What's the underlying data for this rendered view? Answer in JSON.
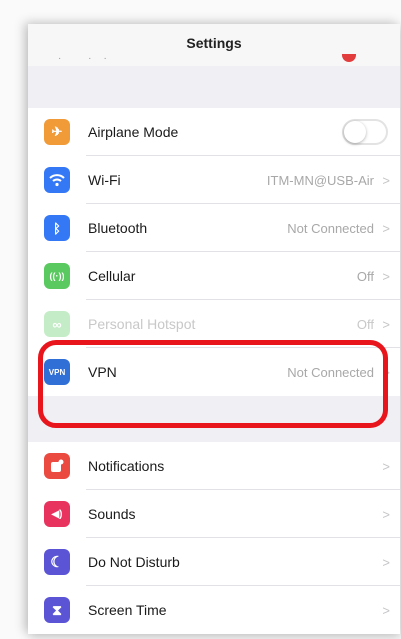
{
  "navbar": {
    "title": "Settings"
  },
  "group1": [
    {
      "name": "airplane",
      "icon": "airplane-icon",
      "color": "#f19a38",
      "glyph": "✈",
      "label": "Airplane Mode",
      "toggle": true,
      "toggle_on": false
    },
    {
      "name": "wifi",
      "icon": "wifi-icon",
      "color": "#3478f6",
      "glyph": "◠",
      "label": "Wi-Fi",
      "value": "ITM-MN@USB-Air"
    },
    {
      "name": "bluetooth",
      "icon": "bluetooth-icon",
      "color": "#3478f6",
      "glyph": "ᛒ",
      "label": "Bluetooth",
      "value": "Not Connected"
    },
    {
      "name": "cellular",
      "icon": "cellular-icon",
      "color": "#5ac95f",
      "glyph": "((·))",
      "label": "Cellular",
      "value": "Off"
    },
    {
      "name": "personal-hotspot",
      "icon": "hotspot-icon",
      "color": "#5ac95f",
      "glyph": "∞",
      "label": "Personal Hotspot",
      "value": "Off"
    },
    {
      "name": "vpn",
      "icon": "vpn-icon",
      "color": "#2f6fd6",
      "glyph": "VPN",
      "label": "VPN",
      "value": "Not Connected"
    }
  ],
  "group2": [
    {
      "name": "notifications",
      "icon": "notifications-icon",
      "color": "#ea4a3f",
      "glyph": "▣",
      "label": "Notifications"
    },
    {
      "name": "sounds",
      "icon": "sounds-icon",
      "color": "#e8335e",
      "glyph": "◀)",
      "label": "Sounds"
    },
    {
      "name": "do-not-disturb",
      "icon": "moon-icon",
      "color": "#5b55d6",
      "glyph": "☾",
      "label": "Do Not Disturb"
    },
    {
      "name": "screen-time",
      "icon": "hourglass-icon",
      "color": "#5b55d6",
      "glyph": "⧗",
      "label": "Screen Time"
    }
  ],
  "colors": {
    "highlight": "#e8161c"
  }
}
